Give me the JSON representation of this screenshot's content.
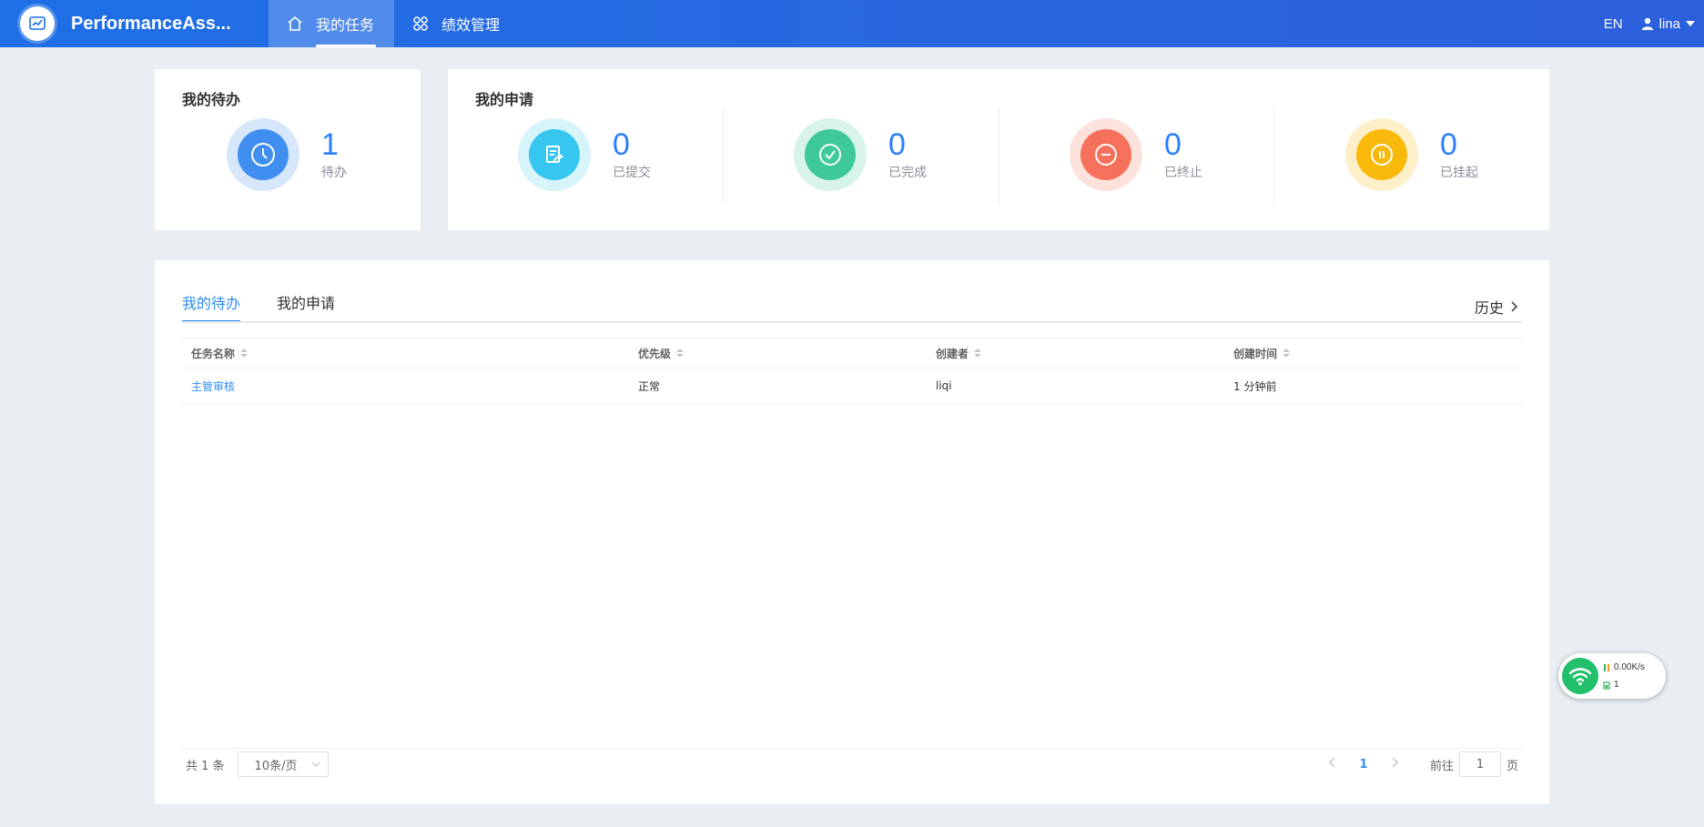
{
  "header": {
    "app_title": "PerformanceAss...",
    "nav": [
      {
        "label": "我的任务",
        "icon": "home-icon",
        "active": true
      },
      {
        "label": "绩效管理",
        "icon": "grid-icon",
        "active": false
      }
    ],
    "lang": "EN",
    "user": "lina"
  },
  "todo_card": {
    "title": "我的待办",
    "count": "1",
    "label": "待办"
  },
  "apply_card": {
    "title": "我的申请",
    "stats": [
      {
        "count": "0",
        "label": "已提交",
        "icon": "submit-icon",
        "color": "#36c6f0"
      },
      {
        "count": "0",
        "label": "已完成",
        "icon": "check-icon",
        "color": "#3ec99a"
      },
      {
        "count": "0",
        "label": "已终止",
        "icon": "minus-icon",
        "color": "#f6715b"
      },
      {
        "count": "0",
        "label": "已挂起",
        "icon": "pause-icon",
        "color": "#f9b90b"
      }
    ]
  },
  "tabs": [
    {
      "label": "我的待办",
      "active": true
    },
    {
      "label": "我的申请",
      "active": false
    }
  ],
  "history_label": "历史",
  "table": {
    "columns": [
      "任务名称",
      "优先级",
      "创建者",
      "创建时间"
    ],
    "rows": [
      {
        "name": "主管审核",
        "priority": "正常",
        "creator": "liqi",
        "created": "1 分钟前"
      }
    ]
  },
  "pagination": {
    "total": "共 1 条",
    "page_size": "10条/页",
    "current_page": "1",
    "goto_label": "前往",
    "goto_value": "1",
    "page_suffix": "页"
  },
  "network_widget": {
    "speed": "0.00K/s",
    "count": "1"
  },
  "colors": {
    "accent": "#2d8cf0",
    "header": "#1e6fe6",
    "todo_icon": "#3f8ef0"
  }
}
